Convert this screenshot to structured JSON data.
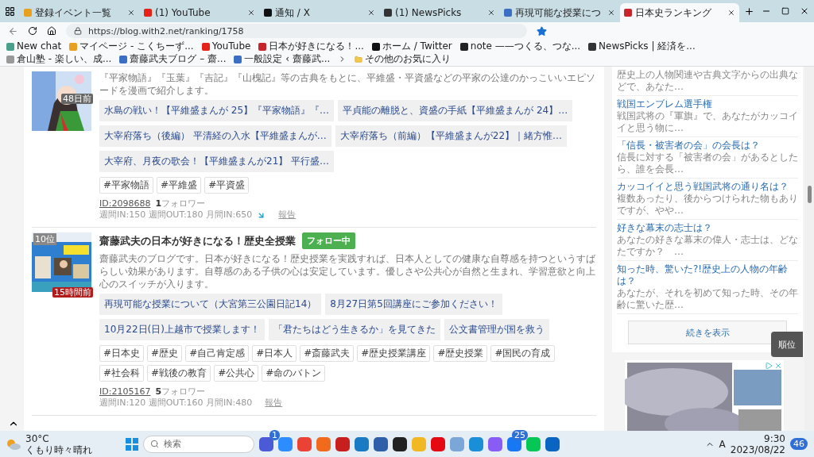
{
  "browser": {
    "tabs": [
      {
        "title": "登録イベント一覧",
        "color": "#e8a020",
        "selected": false
      },
      {
        "title": "(1) YouTube",
        "color": "#e62117",
        "selected": false
      },
      {
        "title": "通知 / X",
        "color": "#111111",
        "selected": false
      },
      {
        "title": "(1) NewsPicks",
        "color": "#333333",
        "selected": false
      },
      {
        "title": "再現可能な授業につ",
        "color": "#3a6fc4",
        "selected": false
      },
      {
        "title": "日本史ランキング",
        "color": "#c8242c",
        "selected": true
      }
    ],
    "address": "https://blog.with2.net/ranking/1758",
    "bookmarks": [
      {
        "label": "New chat",
        "color": "#4aa08a"
      },
      {
        "label": "マイページ - こくちーず...",
        "color": "#e8a020"
      },
      {
        "label": "YouTube",
        "color": "#e62117"
      },
      {
        "label": "日本が好きになる！...",
        "color": "#c8242c"
      },
      {
        "label": "ホーム / Twitter",
        "color": "#111111"
      },
      {
        "label": "note ——つくる、つな...",
        "color": "#222222"
      },
      {
        "label": "NewsPicks | 経済を...",
        "color": "#333333"
      },
      {
        "label": "倉山塾 - 楽しい、成...",
        "color": "#999999"
      },
      {
        "label": "齋藤武夫ブログ – 齋...",
        "color": "#3a6fc4"
      },
      {
        "label": "一般設定 ‹ 齋藤武...",
        "color": "#3a6fc4"
      }
    ],
    "other_favorites": "その他のお気に入り"
  },
  "entries": [
    {
      "description": "『平家物語』『玉葉』『吉記』『山槐記』等の古典をもとに、平維盛・平資盛などの平家の公達のかっこいいエピソードを漫画で紹介します。",
      "badge": {
        "text": "48日前",
        "color": "#666666"
      },
      "posts": [
        "水島の戦い！【平維盛まんが 25】『平家物語』『…",
        "平貞能の離脱と、資盛の手紙【平維盛まんが 24】…",
        "大宰府落ち（後編） 平清経の入水【平維盛まんが…",
        "大宰府落ち（前編）【平維盛まんが22】｜緒方惟…",
        "大宰府、月夜の歌会！【平維盛まんが21】 平行盛…"
      ],
      "tags": [
        "#平家物語",
        "#平維盛",
        "#平資盛"
      ],
      "id": "ID:2098688",
      "followers": "1",
      "followers_label": "フォロワー",
      "stats": "週間IN:150 週間OUT:180 月間IN:650",
      "trend_falling": true,
      "report": "報告"
    },
    {
      "rank": "10位",
      "title": "齋藤武夫の日本が好きになる！歴史全授業",
      "follow": {
        "label": "フォロー中",
        "following": true
      },
      "description": "齋藤武夫のブログです。日本が好きになる！歴史授業を実践すれば、日本人としての健康な自尊感を持つというすばらしい効果があります。自尊感のある子供の心は安定しています。優しさや公共心が自然と生まれ、学習意欲と向上心のスイッチが入ります。",
      "badge": {
        "text": "15時間前",
        "color": "#b01c1c"
      },
      "posts": [
        "再現可能な授業について（大宮第三公園日記14）",
        "8月27日第5回講座にご参加ください！",
        "10月22日(日)上越市で授業します！",
        "「君たちはどう生きるか」を見てきた",
        "公文書管理が国を救う"
      ],
      "tags": [
        "#日本史",
        "#歴史",
        "#自己肯定感",
        "#日本人",
        "#斎藤武夫",
        "#歴史授業講座",
        "#歴史授業",
        "#国民の育成",
        "#社会科",
        "#戦後の教育",
        "#公共心",
        "#命のバトン"
      ],
      "id": "ID:2105167",
      "followers": "5",
      "followers_label": "フォロワー",
      "stats": "週間IN:120 週間OUT:160 月間IN:480",
      "report": "報告"
    }
  ],
  "sidebar": {
    "items": [
      {
        "description": "歴史上の人物関連や古典文字からの出典などで、あなた…"
      },
      {
        "title": "戦国エンブレム選手権",
        "description": "戦国武将の『軍旗』で、あなたがカッコイイと思う物に…"
      },
      {
        "title": "「信長・被害者の会」の会長は？",
        "description": "信長に対する「被害者の会」があるとしたら、誰を会長…"
      },
      {
        "title": "カッコイイと思う戦国武将の通り名は？",
        "description": "複数あったり、後からつけられた物もありですが、やや…"
      },
      {
        "title": "好きな幕末の志士は？",
        "description": "あなたの好きな幕末の偉人・志士は、どなたですか？　…"
      },
      {
        "title": "知った時、驚いた?!歴史上の人物の年齢は？",
        "description": "あなたが、それを初めて知った時、その年齢に驚いた歴…"
      }
    ],
    "more": "続きを表示"
  },
  "rank_button": "順位",
  "taskbar": {
    "temperature": "30°C",
    "weather": "くもり時々晴れ",
    "search_placeholder": "検索",
    "apps": [
      {
        "color": "#4b5bd6",
        "badge": "1"
      },
      {
        "color": "#2d8cff"
      },
      {
        "color": "#ea4335"
      },
      {
        "color": "#f26b1d"
      },
      {
        "color": "#c81e1e"
      },
      {
        "color": "#1a7bc4"
      },
      {
        "color": "#2f5fa8"
      },
      {
        "color": "#222222"
      },
      {
        "color": "#f2b824"
      },
      {
        "color": "#e50914"
      },
      {
        "color": "#7aa7d8"
      },
      {
        "color": "#1a8fd8"
      },
      {
        "color": "#8a5cf6"
      },
      {
        "color": "#1877f2",
        "badge": "25"
      },
      {
        "color": "#06c755"
      },
      {
        "color": "#0a64c2"
      }
    ],
    "ime": "A",
    "time": "9:30",
    "date": "2023/08/22",
    "notifications": "46"
  }
}
